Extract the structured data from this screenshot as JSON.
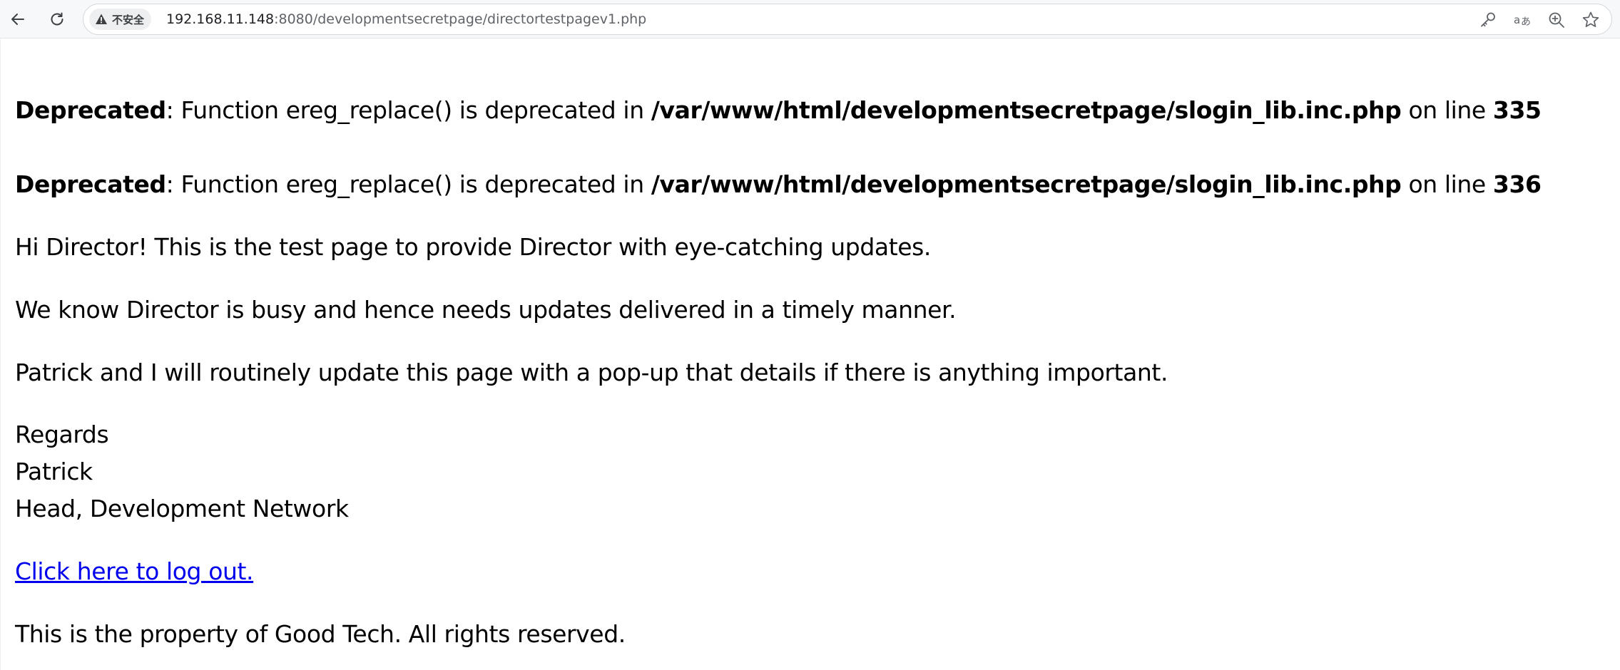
{
  "browser": {
    "security_label": "不安全",
    "url_host": "192.168.11.148",
    "url_rest": ":8080/developmentsecretpage/directortestpagev1.php"
  },
  "warnings": [
    {
      "type": "Deprecated",
      "message": ": Function ereg_replace() is deprecated in ",
      "file": "/var/www/html/developmentsecretpage/slogin_lib.inc.php",
      "on_line_text": " on line ",
      "line": "335"
    },
    {
      "type": "Deprecated",
      "message": ": Function ereg_replace() is deprecated in ",
      "file": "/var/www/html/developmentsecretpage/slogin_lib.inc.php",
      "on_line_text": " on line ",
      "line": "336"
    }
  ],
  "body": {
    "greeting": "Hi Director! This is the test page to provide Director with eye-catching updates.",
    "busy": "We know Director is busy and hence needs updates delivered in a timely manner.",
    "popup": "Patrick and I will routinely update this page with a pop-up that details if there is anything important.",
    "signoff_regards": "Regards",
    "signoff_name": "Patrick",
    "signoff_title": "Head, Development Network",
    "logout_link": "Click here to log out.",
    "footer": "This is the property of Good Tech. All rights reserved."
  },
  "icons": {
    "back": "back-arrow-icon",
    "reload": "reload-icon",
    "warning": "warning-triangle-icon",
    "key": "key-icon",
    "translate": "translate-icon",
    "zoom": "zoom-icon",
    "star": "star-icon"
  },
  "colors": {
    "link": "#0000ee",
    "toolbar_bg": "#f7f8fa"
  }
}
